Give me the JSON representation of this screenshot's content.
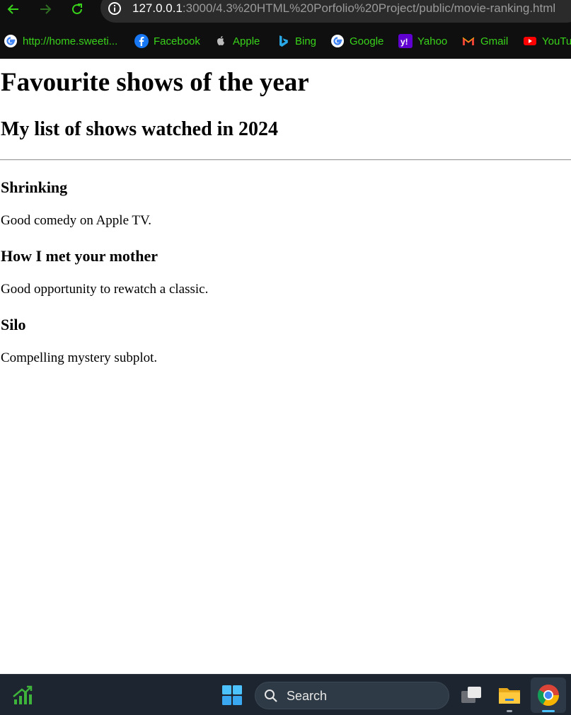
{
  "browser": {
    "url_host": "127.0.0.1",
    "url_path": ":3000/4.3%20HTML%20Porfolio%20Project/public/movie-ranking.html",
    "nav": {
      "back_icon": "arrow-left-icon",
      "forward_icon": "arrow-right-icon",
      "reload_icon": "reload-icon",
      "site_info_icon": "info-icon"
    },
    "bookmarks": [
      {
        "label": "http://home.sweeti...",
        "icon": "google-icon"
      },
      {
        "label": "Facebook",
        "icon": "facebook-icon"
      },
      {
        "label": "Apple",
        "icon": "apple-icon"
      },
      {
        "label": "Bing",
        "icon": "bing-icon"
      },
      {
        "label": "Google",
        "icon": "google-icon"
      },
      {
        "label": "Yahoo",
        "icon": "yahoo-icon"
      },
      {
        "label": "Gmail",
        "icon": "gmail-icon"
      },
      {
        "label": "YouTu",
        "icon": "youtube-icon"
      }
    ],
    "bookmark_color": "#39d21b"
  },
  "page": {
    "title": "Favourite shows of the year",
    "subtitle": "My list of shows watched in 2024",
    "shows": [
      {
        "name": "Shrinking",
        "review": "Good comedy on Apple TV."
      },
      {
        "name": "How I met your mother",
        "review": "Good opportunity to rewatch a classic."
      },
      {
        "name": "Silo",
        "review": "Compelling mystery subplot."
      }
    ]
  },
  "taskbar": {
    "search_placeholder": "Search",
    "items": [
      "stocks-widget-icon",
      "windows-start-icon",
      "search-icon",
      "task-view-icon",
      "file-explorer-icon",
      "chrome-icon"
    ]
  }
}
